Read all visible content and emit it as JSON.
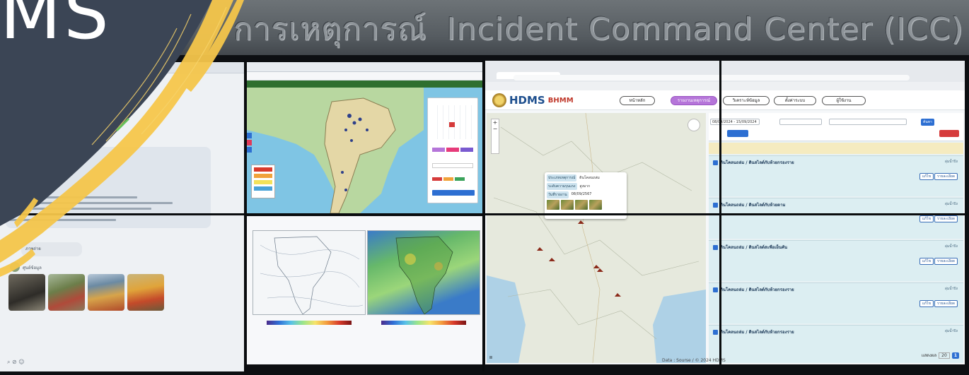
{
  "overlay": {
    "ms_text": "MS"
  },
  "wall_sign": {
    "thai": "การเหตุการณ์",
    "english": "Incident Command Center (ICC)"
  },
  "chat": {
    "attachment_label": "ภาพถ่าย",
    "sender": "ศูนย์ข้อมูล",
    "footer_icons": [
      "attach-icon",
      "clip-icon",
      "emoji-icon"
    ]
  },
  "hdms": {
    "logo_text": "HDMS",
    "logo_secondary": "BHMM",
    "nav": [
      "หน้าหลัก",
      "รายงานเหตุการณ์",
      "วิเคราะห์ข้อมูล",
      "ตั้งค่าระบบ",
      "ผู้ใช้งาน"
    ],
    "popup": [
      {
        "k": "ประเภทเหตุการณ์",
        "v": "ดินโคลนถล่ม"
      },
      {
        "k": "ระดับความรุนแรง",
        "v": "สูงมาก"
      },
      {
        "k": "วันที่รายงาน",
        "v": "08/09/2567"
      }
    ],
    "filters": {
      "date_range": "08/09/2024 - 15/09/2024",
      "search_button": "ค้นหา"
    },
    "cards": [
      {
        "title": "ดินโคลนถล่ม / ดินสไลด์กับห้วยกรองราย",
        "tag": "ลุ่มน้ำปิง"
      },
      {
        "title": "ดินโคลนถล่ม / ดินสไลด์กับห้วยตาม",
        "tag": "ลุ่มน้ำปิง"
      },
      {
        "title": "ดินโคลนถล่ม / ดินสไลด์สะพือเย็นคัน",
        "tag": "ลุ่มน้ำปิง"
      },
      {
        "title": "ดินโคลนถล่ม / ดินสไลด์กับห้วยกรองราย",
        "tag": "ลุ่มน้ำปิง"
      },
      {
        "title": "ดินโคลนถล่ม / ดินสไลด์กับห้วยกรองราย",
        "tag": "ลุ่มน้ำปิง"
      }
    ],
    "card_buttons": {
      "view": "แก้ไข",
      "detail": "รายละเอียด"
    },
    "pager": {
      "label": "แสดงผล",
      "per_page": "20",
      "current": "1"
    },
    "credit": "Data : Sourse / © 2024 HDMS"
  }
}
